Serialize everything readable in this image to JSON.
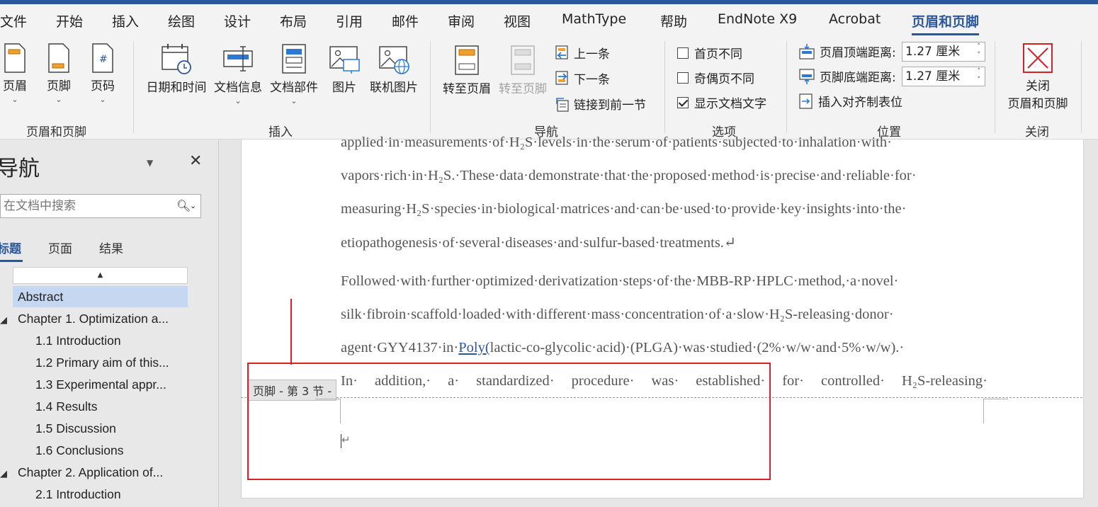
{
  "menu": {
    "tabs": [
      "文件",
      "开始",
      "插入",
      "绘图",
      "设计",
      "布局",
      "引用",
      "邮件",
      "审阅",
      "视图",
      "MathType",
      "帮助",
      "EndNote X9",
      "Acrobat",
      "页眉和页脚"
    ],
    "active": "页眉和页脚"
  },
  "ribbon": {
    "groups": {
      "header_footer": {
        "label": "页眉和页脚",
        "header": "页眉",
        "footer": "页脚",
        "page_number": "页码"
      },
      "insert": {
        "label": "插入",
        "datetime": "日期和时间",
        "docinfo": "文档信息",
        "quickparts": "文档部件",
        "picture": "图片",
        "online_picture": "联机图片"
      },
      "navigation": {
        "label": "导航",
        "goto_header": "转至页眉",
        "goto_footer": "转至页脚",
        "previous": "上一条",
        "next": "下一条",
        "link_previous": "链接到前一节"
      },
      "options": {
        "label": "选项",
        "different_first": "首页不同",
        "different_odd_even": "奇偶页不同",
        "show_doc_text": "显示文档文字",
        "different_first_checked": false,
        "different_odd_even_checked": false,
        "show_doc_text_checked": true
      },
      "position": {
        "label": "位置",
        "header_top_label": "页眉顶端距离:",
        "header_top_value": "1.27 厘米",
        "footer_bottom_label": "页脚底端距离:",
        "footer_bottom_value": "1.27 厘米",
        "insert_align_tab": "插入对齐制表位"
      },
      "close": {
        "label": "关闭",
        "button_line1": "关闭",
        "button_line2": "页眉和页脚"
      }
    }
  },
  "nav_pane": {
    "title": "导航",
    "search_placeholder": "在文档中搜索",
    "tabs": [
      "标题",
      "页面",
      "结果"
    ],
    "active_tab": "标题",
    "items": [
      {
        "text": "Abstract",
        "level": 1,
        "selected": true
      },
      {
        "text": "Chapter 1. Optimization a...",
        "level": 1,
        "expanded": true
      },
      {
        "text": "1.1 Introduction",
        "level": 2
      },
      {
        "text": "1.2 Primary aim of this...",
        "level": 2
      },
      {
        "text": "1.3 Experimental appr...",
        "level": 2
      },
      {
        "text": "1.4 Results",
        "level": 2
      },
      {
        "text": "1.5 Discussion",
        "level": 2
      },
      {
        "text": "1.6 Conclusions",
        "level": 2
      },
      {
        "text": "Chapter 2. Application of...",
        "level": 1,
        "expanded": true
      },
      {
        "text": "2.1 Introduction",
        "level": 2
      }
    ]
  },
  "document": {
    "lines": [
      "applied·in·measurements·of·H₂S·levels·in·the·serum·of·patients·subjected·to·inhalation·with·",
      "vapors·rich·in·H₂S.·These·data·demonstrate·that·the·proposed·method·is·precise·and·reliable·for·",
      "measuring·H₂S·species·in·biological·matrices·and·can·be·used·to·provide·key·insights·into·the·",
      "etiopathogenesis·of·several·diseases·and·sulfur-based·treatments.↵",
      "Followed·with·further·optimized·derivatization·steps·of·the·MBB-RP·HPLC·method,·a·novel·",
      "silk·fibroin·scaffold·loaded·with·different·mass·concentration·of·a·slow·H₂S-releasing·donor·",
      "agent·GYY4137·in·",
      "In·  addition,·  a·  standardized·  procedure·  was·  established·  for·  controlled·  H₂S-releasing·"
    ],
    "line7_link": "Poly(",
    "line7_rest": "lactic-co-glycolic·acid)·(PLGA)·was·studied·(2%·w/w·and·5%·w/w).·",
    "footer_label": "页脚 - 第 3 节 -",
    "footer_paragraph_mark": "↵"
  }
}
